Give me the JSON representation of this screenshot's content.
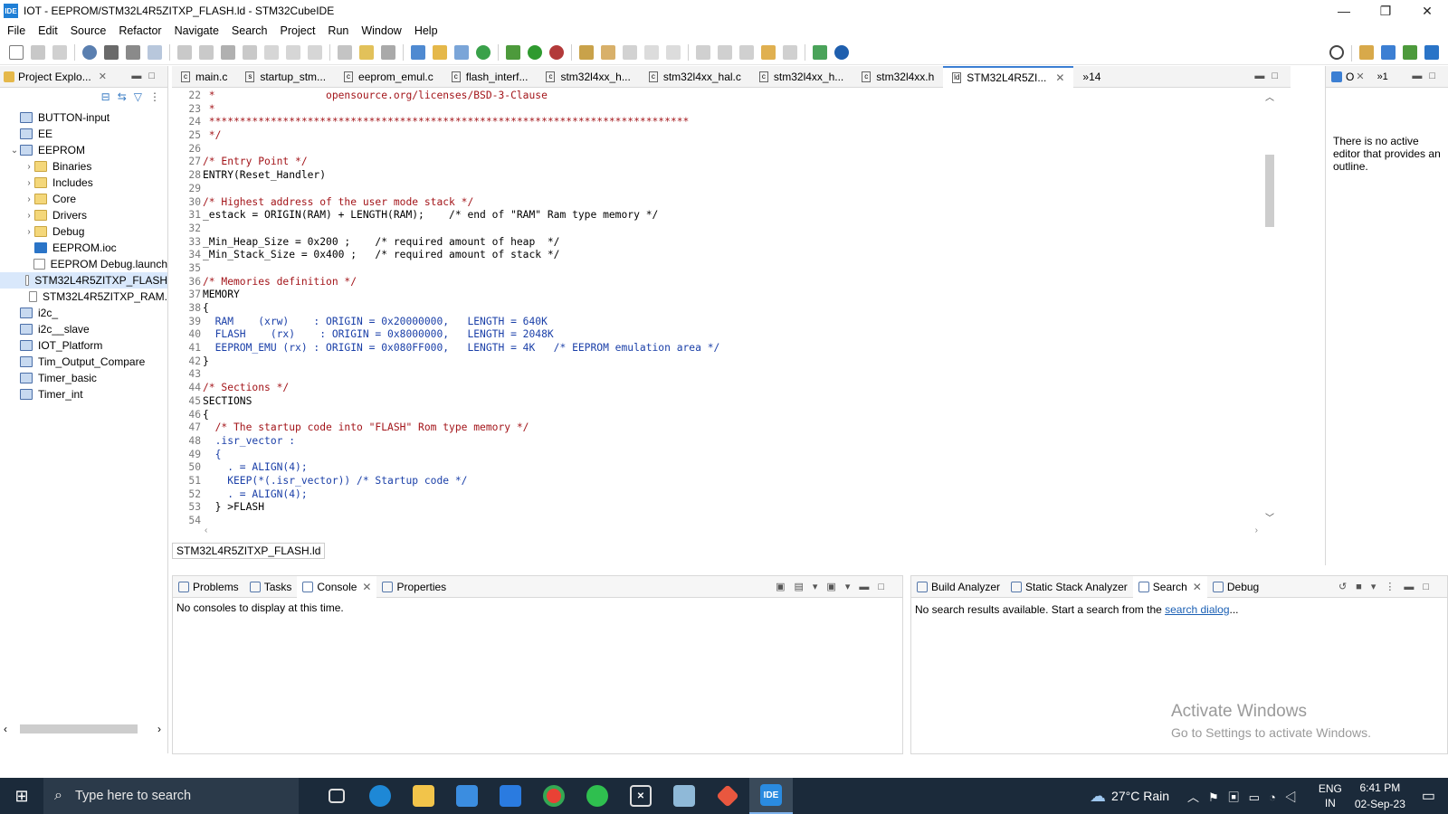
{
  "window": {
    "app_icon_text": "IDE",
    "title": "IOT - EEPROM/STM32L4R5ZITXP_FLASH.ld - STM32CubeIDE",
    "minimize": "—",
    "restore": "❐",
    "close": "✕"
  },
  "menu": [
    "File",
    "Edit",
    "Source",
    "Refactor",
    "Navigate",
    "Search",
    "Project",
    "Run",
    "Window",
    "Help"
  ],
  "explorer": {
    "tab_label": "Project Explo...",
    "items": [
      {
        "label": "BUTTON-input",
        "arrow": "",
        "icon": "project"
      },
      {
        "label": "EE",
        "arrow": "",
        "icon": "project"
      },
      {
        "label": "EEPROM",
        "arrow": "⌄",
        "icon": "ide-project"
      },
      {
        "label": "Binaries",
        "arrow": "›",
        "icon": "folder"
      },
      {
        "label": "Includes",
        "arrow": "›",
        "icon": "folder"
      },
      {
        "label": "Core",
        "arrow": "›",
        "icon": "folder"
      },
      {
        "label": "Drivers",
        "arrow": "›",
        "icon": "folder"
      },
      {
        "label": "Debug",
        "arrow": "›",
        "icon": "folder"
      },
      {
        "label": "EEPROM.ioc",
        "arrow": "",
        "icon": "mx"
      },
      {
        "label": "EEPROM Debug.launch",
        "arrow": "",
        "icon": "file"
      },
      {
        "label": "STM32L4R5ZITXP_FLASH",
        "arrow": "",
        "icon": "file",
        "selected": true
      },
      {
        "label": "STM32L4R5ZITXP_RAM.",
        "arrow": "",
        "icon": "file"
      },
      {
        "label": "i2c_",
        "arrow": "",
        "icon": "project"
      },
      {
        "label": "i2c__slave",
        "arrow": "",
        "icon": "project"
      },
      {
        "label": "IOT_Platform",
        "arrow": "",
        "icon": "project"
      },
      {
        "label": "Tim_Output_Compare",
        "arrow": "",
        "icon": "project"
      },
      {
        "label": "Timer_basic",
        "arrow": "",
        "icon": "project"
      },
      {
        "label": "Timer_int",
        "arrow": "",
        "icon": "project"
      }
    ]
  },
  "editor": {
    "tabs": [
      {
        "label": "main.c",
        "icon": "c"
      },
      {
        "label": "startup_stm...",
        "icon": "s"
      },
      {
        "label": "eeprom_emul.c",
        "icon": "c"
      },
      {
        "label": "flash_interf...",
        "icon": "c"
      },
      {
        "label": "stm32l4xx_h...",
        "icon": "c"
      },
      {
        "label": "stm32l4xx_hal.c",
        "icon": "c"
      },
      {
        "label": "stm32l4xx_h...",
        "icon": "c"
      },
      {
        "label": "stm32l4xx.h",
        "icon": "c"
      },
      {
        "label": "STM32L4R5ZI...",
        "icon": "ld",
        "active": true
      }
    ],
    "overflow_count": "»14",
    "footer_label": "STM32L4R5ZITXP_FLASH.ld",
    "lines": [
      {
        "n": "22",
        "t": " *                  opensource.org/licenses/BSD-3-Clause",
        "k": "cmt"
      },
      {
        "n": "23",
        "t": " *",
        "k": "cmt"
      },
      {
        "n": "24",
        "t": " ******************************************************************************",
        "k": "cmt"
      },
      {
        "n": "25",
        "t": " */",
        "k": "cmt"
      },
      {
        "n": "26",
        "t": "",
        "k": "ct"
      },
      {
        "n": "27",
        "t": "/* Entry Point */",
        "k": "cmt"
      },
      {
        "n": "28",
        "t": "ENTRY(Reset_Handler)",
        "k": "ct"
      },
      {
        "n": "29",
        "t": "",
        "k": "ct"
      },
      {
        "n": "30",
        "t": "/* Highest address of the user mode stack */",
        "k": "cmt"
      },
      {
        "n": "31",
        "t": "_estack = ORIGIN(RAM) + LENGTH(RAM);    /* end of \"RAM\" Ram type memory */",
        "k": "ct"
      },
      {
        "n": "32",
        "t": "",
        "k": "ct"
      },
      {
        "n": "33",
        "t": "_Min_Heap_Size = 0x200 ;    /* required amount of heap  */",
        "k": "ct"
      },
      {
        "n": "34",
        "t": "_Min_Stack_Size = 0x400 ;   /* required amount of stack */",
        "k": "ct"
      },
      {
        "n": "35",
        "t": "",
        "k": "ct"
      },
      {
        "n": "36",
        "t": "/* Memories definition */",
        "k": "cmt"
      },
      {
        "n": "37",
        "t": "MEMORY",
        "k": "ct"
      },
      {
        "n": "38",
        "t": "{",
        "k": "ct"
      },
      {
        "n": "39",
        "t": "  RAM    (xrw)    : ORIGIN = 0x20000000,   LENGTH = 640K",
        "k": "num"
      },
      {
        "n": "40",
        "t": "  FLASH    (rx)    : ORIGIN = 0x8000000,   LENGTH = 2048K",
        "k": "num"
      },
      {
        "n": "41",
        "t": "  EEPROM_EMU (rx) : ORIGIN = 0x080FF000,   LENGTH = 4K   /* EEPROM emulation area */",
        "k": "num"
      },
      {
        "n": "42",
        "t": "}",
        "k": "ct"
      },
      {
        "n": "43",
        "t": "",
        "k": "ct"
      },
      {
        "n": "44",
        "t": "/* Sections */",
        "k": "cmt"
      },
      {
        "n": "45",
        "t": "SECTIONS",
        "k": "ct"
      },
      {
        "n": "46",
        "t": "{",
        "k": "ct"
      },
      {
        "n": "47",
        "t": "  /* The startup code into \"FLASH\" Rom type memory */",
        "k": "cmt"
      },
      {
        "n": "48",
        "t": "  .isr_vector :",
        "k": "num"
      },
      {
        "n": "49",
        "t": "  {",
        "k": "num"
      },
      {
        "n": "50",
        "t": "    . = ALIGN(4);",
        "k": "num"
      },
      {
        "n": "51",
        "t": "    KEEP(*(.isr_vector)) /* Startup code */",
        "k": "num"
      },
      {
        "n": "52",
        "t": "    . = ALIGN(4);",
        "k": "num"
      },
      {
        "n": "53",
        "t": "  } >FLASH",
        "k": "ct"
      },
      {
        "n": "54",
        "t": "",
        "k": "ct"
      }
    ]
  },
  "outline": {
    "tab_label": "O",
    "overflow": "»1",
    "message": "There is no active editor that provides an outline."
  },
  "console_panel": {
    "tabs": [
      "Problems",
      "Tasks",
      "Console",
      "Properties"
    ],
    "message": "No consoles to display at this time."
  },
  "search_panel": {
    "tabs": [
      "Build Analyzer",
      "Static Stack Analyzer",
      "Search",
      "Debug"
    ],
    "message_prefix": "No search results available. Start a search from the ",
    "link": "search dialog",
    "message_suffix": "..."
  },
  "activation": {
    "title": "Activate Windows",
    "subtitle": "Go to Settings to activate Windows."
  },
  "taskbar": {
    "search_placeholder": "Type here to search",
    "weather": "27°C  Rain",
    "lang_top": "ENG",
    "lang_bottom": "IN",
    "time": "6:41 PM",
    "date": "02-Sep-23",
    "apps": [
      "task-view",
      "edge",
      "file-explorer",
      "store",
      "mail",
      "chrome",
      "whatsapp",
      "xbox",
      "notes",
      "git",
      "stm32cubeide"
    ]
  },
  "colors": {
    "accent": "#3c7fd3",
    "comment": "#a3151a",
    "code_blue": "#1a3fa8",
    "string_green": "#2a7a2a",
    "taskbar": "#1b2a3a"
  }
}
